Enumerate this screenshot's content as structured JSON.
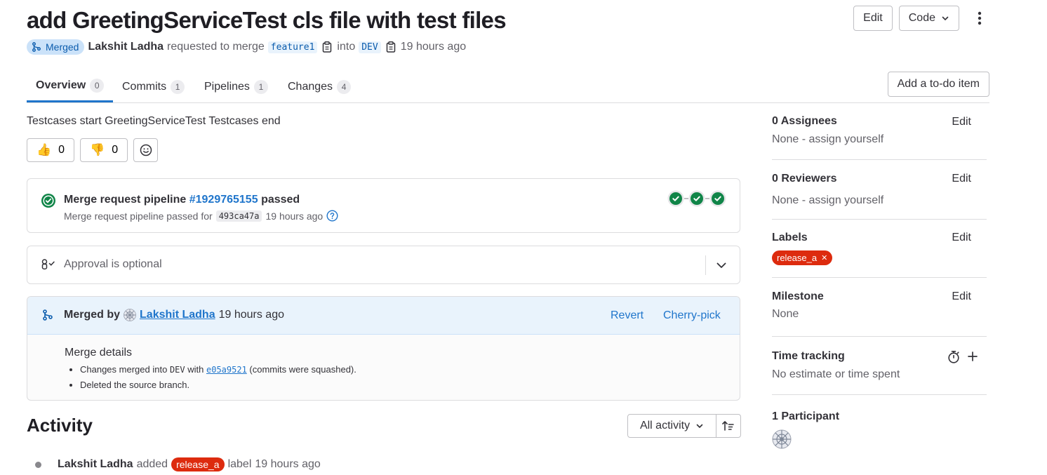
{
  "header": {
    "title": "add GreetingServiceTest cls file with test files",
    "edit_label": "Edit",
    "code_label": "Code",
    "status_badge": "Merged",
    "author": "Lakshit Ladha",
    "requested_text": "requested to merge",
    "source_branch": "feature1",
    "into_text": "into",
    "target_branch": "DEV",
    "time": "19 hours ago"
  },
  "tabs": [
    {
      "label": "Overview",
      "count": "0"
    },
    {
      "label": "Commits",
      "count": "1"
    },
    {
      "label": "Pipelines",
      "count": "1"
    },
    {
      "label": "Changes",
      "count": "4"
    }
  ],
  "todo_label": "Add a to-do item",
  "description": "Testcases start GreetingServiceTest Testcases end",
  "reactions": {
    "thumbs_up": "0",
    "thumbs_down": "0"
  },
  "pipeline": {
    "title_prefix": "Merge request pipeline",
    "id": "#1929765155",
    "status": "passed",
    "sub_prefix": "Merge request pipeline passed for",
    "sha": "493ca47a",
    "time": "19 hours ago"
  },
  "approval": {
    "text": "Approval is optional"
  },
  "merged": {
    "prefix": "Merged by",
    "by": "Lakshit Ladha",
    "time": "19 hours ago",
    "revert_label": "Revert",
    "cherry_label": "Cherry-pick",
    "details_title": "Merge details",
    "line1_a": "Changes merged into",
    "line1_branch": "DEV",
    "line1_b": "with",
    "line1_commit": "e05a9521",
    "line1_c": "(commits were squashed).",
    "line2": "Deleted the source branch."
  },
  "activity": {
    "title": "Activity",
    "filter_label": "All activity",
    "event_author": "Lakshit Ladha",
    "event_added": "added",
    "event_label": "release_a",
    "event_suffix": "label",
    "event_time": "19 hours ago"
  },
  "sidebar": {
    "assignees": {
      "title": "0 Assignees",
      "edit": "Edit",
      "value": "None - assign yourself"
    },
    "reviewers": {
      "title": "0 Reviewers",
      "edit": "Edit",
      "value": "None - assign yourself"
    },
    "labels": {
      "title": "Labels",
      "edit": "Edit",
      "label": "release_a"
    },
    "milestone": {
      "title": "Milestone",
      "edit": "Edit",
      "value": "None"
    },
    "time_tracking": {
      "title": "Time tracking",
      "value": "No estimate or time spent"
    },
    "participants": {
      "title": "1 Participant"
    }
  },
  "colors": {
    "accent": "#1f75cb",
    "success": "#108548",
    "label": "#dd2b0e",
    "merged_badge_bg": "#cbe2f9"
  }
}
